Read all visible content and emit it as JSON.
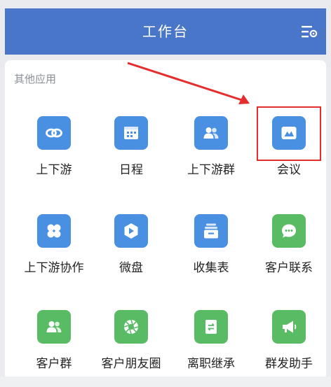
{
  "header": {
    "title": "工作台",
    "background": "#4a76c9",
    "settings_icon": "settings-list-icon"
  },
  "section": {
    "title": "其他应用"
  },
  "apps": [
    {
      "label": "上下游",
      "icon": "chain-link-icon",
      "color": "#4a90e2"
    },
    {
      "label": "日程",
      "icon": "calendar-icon",
      "color": "#4a90e2"
    },
    {
      "label": "上下游群",
      "icon": "group-users-icon",
      "color": "#4a90e2"
    },
    {
      "label": "会议",
      "icon": "meeting-icon",
      "color": "#4a90e2"
    },
    {
      "label": "上下游协作",
      "icon": "four-circles-icon",
      "color": "#4a90e2"
    },
    {
      "label": "微盘",
      "icon": "drive-icon",
      "color": "#4a90e2"
    },
    {
      "label": "收集表",
      "icon": "form-icon",
      "color": "#4a90e2"
    },
    {
      "label": "客户联系",
      "icon": "chat-bubble-icon",
      "color": "#59bb64"
    },
    {
      "label": "客户群",
      "icon": "customer-group-icon",
      "color": "#59bb64"
    },
    {
      "label": "客户朋友圈",
      "icon": "aperture-icon",
      "color": "#59bb64"
    },
    {
      "label": "离职继承",
      "icon": "transfer-icon",
      "color": "#59bb64"
    },
    {
      "label": "群发助手",
      "icon": "megaphone-icon",
      "color": "#59bb64"
    }
  ],
  "annotation": {
    "highlight_color": "#e52d2d"
  }
}
